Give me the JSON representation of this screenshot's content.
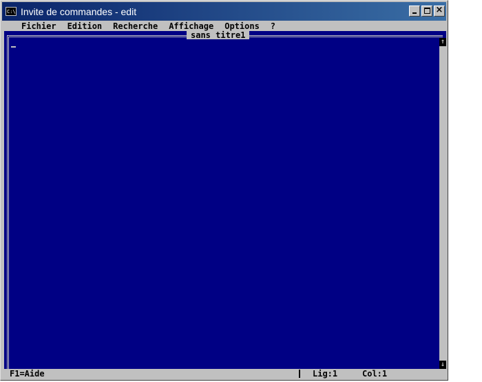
{
  "window": {
    "title": "Invite de commandes - edit",
    "icon": "C:\\",
    "buttons": {
      "minimize": "minimize-icon",
      "maximize": "maximize-icon",
      "close": "×"
    }
  },
  "menu": {
    "items": [
      {
        "label": "Fichier"
      },
      {
        "label": "Edition"
      },
      {
        "label": "Recherche"
      },
      {
        "label": "Affichage"
      },
      {
        "label": "Options"
      },
      {
        "label": "?"
      }
    ]
  },
  "editor": {
    "document_title": "sans titre1",
    "content": "",
    "scroll_up": "↑",
    "scroll_down": "↓"
  },
  "status": {
    "help": "F1=Aide",
    "line": "Lig:1",
    "column": "Col:1"
  },
  "colors": {
    "background": "#000084",
    "chrome": "#c0c0c0",
    "title_start": "#0a246a",
    "title_end": "#3a6ea5"
  }
}
